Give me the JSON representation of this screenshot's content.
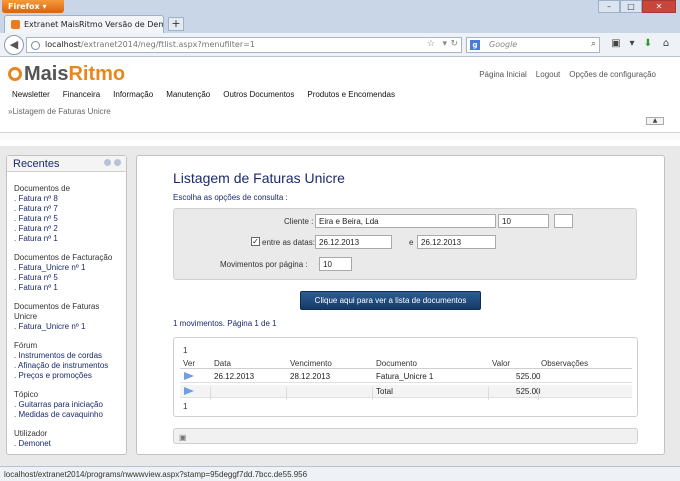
{
  "browser": {
    "app_button": "Firefox",
    "tab_title": "Extranet MaisRitmo Versão de Demonstr...",
    "new_tab": "+",
    "url_host": "localhost",
    "url_path": "/extranet2014/neg/ftlist.aspx?menufilter=1",
    "search_placeholder": "Google",
    "search_engine": "g"
  },
  "logo": {
    "mais": "Mais",
    "ritmo": "Ritmo"
  },
  "top_links": [
    "Página Inicial",
    "Logout",
    "Opções de configuração"
  ],
  "menu": [
    "Newsletter",
    "Financeira",
    "Informação",
    "Manutenção",
    "Outros Documentos",
    "Produtos e Encomendas"
  ],
  "breadcrumb": "»Listagem de Faturas Unicre",
  "sidebar": {
    "title": "Recentes",
    "groups": [
      {
        "title": "Documentos de",
        "links": [
          ". Fatura nº 8",
          ". Fatura nº 7",
          ". Fatura nº 5",
          ". Fatura nº 2",
          ". Fatura nº 1"
        ]
      },
      {
        "title": "Documentos de Facturação",
        "links": [
          ". Fatura_Unicre nº 1",
          ". Fatura nº 5",
          ". Fatura nº 1"
        ]
      },
      {
        "title": "Documentos de Faturas Unicre",
        "links": [
          ". Fatura_Unicre nº 1"
        ]
      },
      {
        "title": "Fórum",
        "links": [
          ". Instrumentos de cordas",
          ". Afinação de instrumentos",
          ". Preços e promoções"
        ]
      },
      {
        "title": "Tópico",
        "links": [
          ". Guitarras para iniciação",
          ". Medidas de cavaquinho"
        ]
      },
      {
        "title": "Utilizador",
        "links": [
          ". Demonet"
        ]
      }
    ]
  },
  "main": {
    "title": "Listagem de Faturas Unicre",
    "subtitle": "Escolha as opções de consulta :",
    "filter": {
      "cliente_label": "Cliente :",
      "cliente_name": "Eira e Beira, Lda",
      "cliente_code": "10",
      "dates_label": "entre as datas:",
      "date_from": "26.12.2013",
      "date_and": "e",
      "date_to": "26.12.2013",
      "per_page_label": "Movimentos por página :",
      "per_page": "10",
      "dates_checked": true
    },
    "submit_label": "Clique aqui para ver a lista de documentos",
    "summary": "1 movimentos. Página 1 de 1",
    "table": {
      "pager_top": "1",
      "pager_bottom": "1",
      "headers": [
        "Ver",
        "Data",
        "Vencimento",
        "Documento",
        "Valor",
        "Observações"
      ],
      "rows": [
        {
          "data": "26.12.2013",
          "vencimento": "28.12.2013",
          "documento": "Fatura_Unicre 1",
          "valor": "525.00",
          "observacoes": ""
        }
      ],
      "total_label": "Total",
      "total_value": "525.00"
    }
  },
  "status_url": "localhost/extranet2014/programs/nwwwview.aspx?stamp=95deggf7dd.7bcc.de55.956",
  "colors": {
    "brand_orange": "#e8871e",
    "link_blue": "#1b2a6b",
    "button_blue": "#1f4a7d"
  }
}
